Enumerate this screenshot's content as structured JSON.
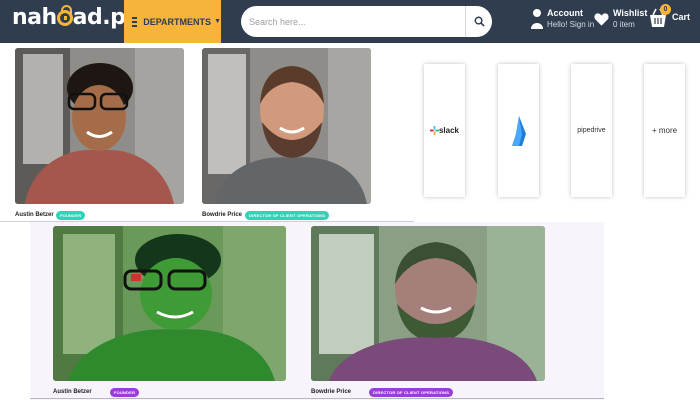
{
  "header": {
    "logo_text_1": "nah",
    "logo_text_2": "ad.pk",
    "departments_label": "DEPARTMENTS",
    "search_placeholder": "Search here...",
    "account_title": "Account",
    "account_sub": "Hello! Sign in",
    "wishlist_title": "Wishlist",
    "wishlist_sub": "0 item",
    "cart_label": "Cart",
    "cart_count": "0"
  },
  "team_top": [
    {
      "name": "Austin Betzer",
      "role": "FOUNDER"
    },
    {
      "name": "Bowdrie Price",
      "role": "DIRECTOR OF CLIENT OPERATIONS"
    }
  ],
  "integrations": [
    "slack",
    "",
    "pipedrive",
    "+ more"
  ],
  "team_bottom": [
    {
      "name": "Austin Betzer",
      "role": "FOUNDER"
    },
    {
      "name": "Bowdrie Price",
      "role": "DIRECTOR OF CLIENT OPERATIONS"
    }
  ],
  "colors": {
    "header_bg": "#2f3d4f",
    "accent": "#f6b43a",
    "badge_teal": "#2fd3b8",
    "badge_purple": "#9b3ed8"
  }
}
